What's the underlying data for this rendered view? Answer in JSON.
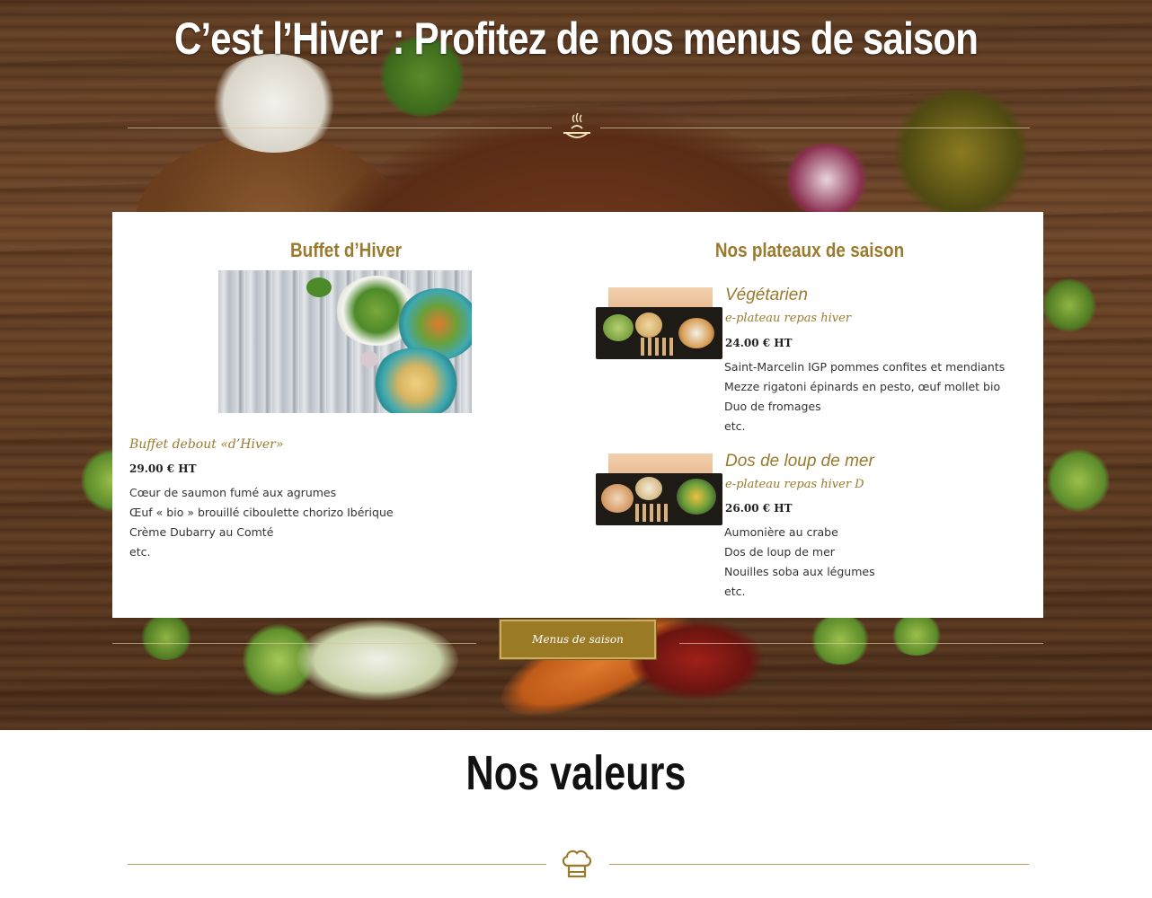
{
  "hero": {
    "title": "C’est l’Hiver : Profitez de nos menus de saison",
    "divider_icon": "dish-icon"
  },
  "buffet": {
    "heading": "Buffet d’Hiver",
    "image": "salad-bowls-photo",
    "name": "Buffet debout «d’Hiver»",
    "price": "29.00 € HT",
    "items": [
      "Cœur de saumon fumé aux agrumes",
      "Œuf « bio » brouillé ciboulette chorizo Ibérique",
      "Crème Dubarry au Comté",
      "etc."
    ]
  },
  "plateaux": {
    "heading": "Nos plateaux de saison",
    "products": [
      {
        "title": "Végétarien",
        "subtitle": "e-plateau repas hiver",
        "price": "24.00 € HT",
        "items": [
          "Saint-Marcelin IGP pommes confites et mendiants",
          "Mezze rigatoni épinards en pesto, œuf mollet bio",
          "Duo de fromages",
          "etc."
        ]
      },
      {
        "title": "Dos de loup de mer",
        "subtitle": "e-plateau repas hiver D",
        "price": "26.00 € HT",
        "items": [
          "Aumonière au crabe",
          "Dos de loup de mer",
          "Nouilles soba aux légumes",
          "etc."
        ]
      }
    ]
  },
  "cta": {
    "label": "Menus de saison"
  },
  "valeurs": {
    "title": "Nos valeurs",
    "icon": "chef-hat-icon"
  },
  "colors": {
    "gold": "#9a7a2c",
    "button_bg": "#9b7a25",
    "wood": "#5a3a22"
  }
}
